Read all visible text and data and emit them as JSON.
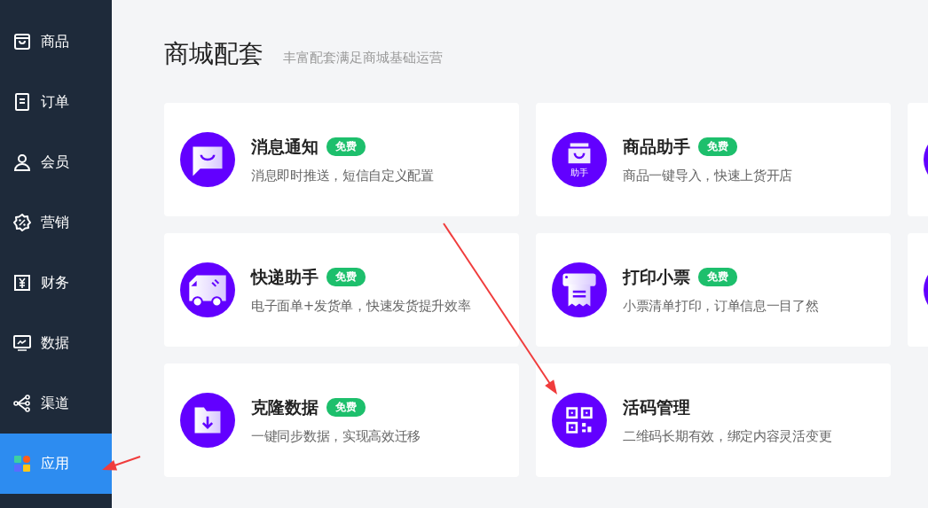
{
  "sidebar": {
    "items": [
      {
        "label": "商品",
        "selected": false
      },
      {
        "label": "订单",
        "selected": false
      },
      {
        "label": "会员",
        "selected": false
      },
      {
        "label": "营销",
        "selected": false
      },
      {
        "label": "财务",
        "selected": false
      },
      {
        "label": "数据",
        "selected": false
      },
      {
        "label": "渠道",
        "selected": false
      },
      {
        "label": "应用",
        "selected": true
      }
    ]
  },
  "section": {
    "title": "商城配套",
    "subtitle": "丰富配套满足商城基础运营"
  },
  "cards": [
    {
      "kind": "message",
      "title": "消息通知",
      "badge": "免费",
      "description": "消息即时推送，短信自定义配置"
    },
    {
      "kind": "bag",
      "icon_label": "助手",
      "title": "商品助手",
      "badge": "免费",
      "description": "商品一键导入，快速上货开店"
    },
    {
      "kind": "partial"
    },
    {
      "kind": "truck",
      "title": "快递助手",
      "badge": "免费",
      "description": "电子面单+发货单，快速发货提升效率"
    },
    {
      "kind": "printer",
      "title": "打印小票",
      "badge": "免费",
      "description": "小票清单打印，订单信息一目了然"
    },
    {
      "kind": "partial"
    },
    {
      "kind": "folder",
      "title": "克隆数据",
      "badge": "免费",
      "description": "一键同步数据，实现高效迁移"
    },
    {
      "kind": "qrcode",
      "title": "活码管理",
      "description": "二维码长期有效，绑定内容灵活变更"
    }
  ],
  "annotations": [
    {
      "kind": "arrow"
    },
    {
      "kind": "arrow"
    }
  ]
}
